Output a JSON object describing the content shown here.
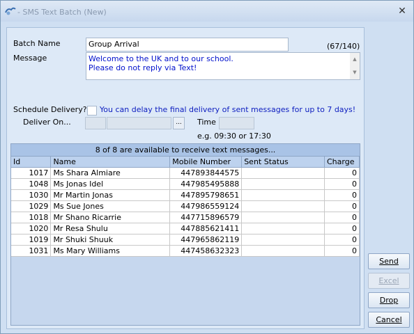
{
  "window": {
    "title": "- SMS Text Batch (New)"
  },
  "form": {
    "batch_name_label": "Batch Name",
    "batch_name_value": "Group Arrival",
    "char_count": "(67/140)",
    "message_label": "Message",
    "message_line1": "Welcome to the UK and to our school.",
    "message_line2": "Please do not reply via Text!",
    "schedule_label": "Schedule Delivery?",
    "schedule_note": "You can delay the final delivery of sent messages for up to 7 days!",
    "deliver_on_label": "Deliver On...",
    "ellipsis_label": "...",
    "time_label": "Time",
    "time_hint": "e.g. 09:30 or 17:30"
  },
  "grid": {
    "caption": "8 of 8 are available to receive text messages...",
    "columns": [
      "Id",
      "Name",
      "Mobile Number",
      "Sent Status",
      "Charge"
    ],
    "rows": [
      {
        "id": "1017",
        "name": "Ms Shara Almiare",
        "mobile": "447893844575",
        "status": "",
        "charge": "0"
      },
      {
        "id": "1048",
        "name": "Ms Jonas Idel",
        "mobile": "447985495888",
        "status": "",
        "charge": "0"
      },
      {
        "id": "1030",
        "name": "Mr Martin Jonas",
        "mobile": "447895798651",
        "status": "",
        "charge": "0"
      },
      {
        "id": "1029",
        "name": "Ms Sue Jones",
        "mobile": "447986559124",
        "status": "",
        "charge": "0"
      },
      {
        "id": "1018",
        "name": "Mr Shano Ricarrie",
        "mobile": "447715896579",
        "status": "",
        "charge": "0"
      },
      {
        "id": "1020",
        "name": "Mr Resa Shulu",
        "mobile": "447885621411",
        "status": "",
        "charge": "0"
      },
      {
        "id": "1019",
        "name": "Mr Shuki Shuuk",
        "mobile": "447965862119",
        "status": "",
        "charge": "0"
      },
      {
        "id": "1031",
        "name": "Ms Mary Williams",
        "mobile": "447458632323",
        "status": "",
        "charge": "0"
      }
    ]
  },
  "buttons": {
    "send": "Send",
    "excel": "Excel",
    "drop": "Drop",
    "cancel": "Cancel"
  }
}
